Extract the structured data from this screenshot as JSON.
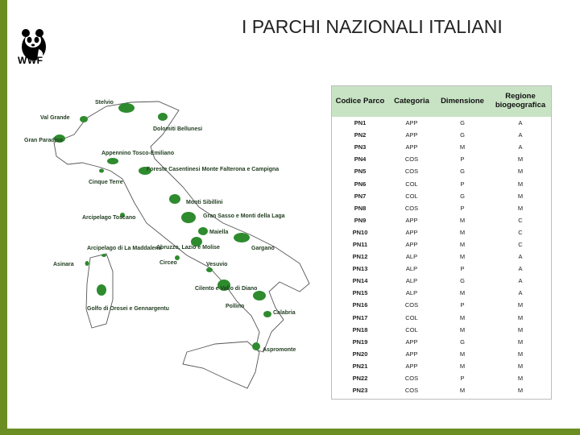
{
  "slide": {
    "title": "I PARCHI NAZIONALI ITALIANI",
    "logo_text": "WWF",
    "colors": {
      "frame": "#6b8e23",
      "header_fill": "#c8e3c4",
      "park_green": "#2e8b2e"
    }
  },
  "map": {
    "labels": [
      {
        "text": "Stelvio"
      },
      {
        "text": "Val Grande"
      },
      {
        "text": "Gran Paradiso"
      },
      {
        "text": "Dolomiti Bellunesi"
      },
      {
        "text": "Appennino Tosco-Emiliano"
      },
      {
        "text": "Foreste Casentinesi Monte Falterona e Campigna"
      },
      {
        "text": "Cinque Terre"
      },
      {
        "text": "Monti Sibillini"
      },
      {
        "text": "Arcipelago Toscano"
      },
      {
        "text": "Gran Sasso e Monti della Laga"
      },
      {
        "text": "Maiella"
      },
      {
        "text": "Gargano"
      },
      {
        "text": "Arcipelago di La Maddalena"
      },
      {
        "text": "Abruzzo, Lazio e Molise"
      },
      {
        "text": "Asinara"
      },
      {
        "text": "Circeo"
      },
      {
        "text": "Vesuvio"
      },
      {
        "text": "Cilento e Vallo di Diano"
      },
      {
        "text": "Golfo di Orosei e Gennargentu"
      },
      {
        "text": "Pollino"
      },
      {
        "text": "Calabria"
      },
      {
        "text": "Aspromonte"
      }
    ]
  },
  "table": {
    "headers": [
      "Codice Parco",
      "Categoria",
      "Dimensione",
      "Regione biogeografica"
    ],
    "rows": [
      [
        "PN1",
        "APP",
        "G",
        "A"
      ],
      [
        "PN2",
        "APP",
        "G",
        "A"
      ],
      [
        "PN3",
        "APP",
        "M",
        "A"
      ],
      [
        "PN4",
        "COS",
        "P",
        "M"
      ],
      [
        "PN5",
        "COS",
        "G",
        "M"
      ],
      [
        "PN6",
        "COL",
        "P",
        "M"
      ],
      [
        "PN7",
        "COL",
        "G",
        "M"
      ],
      [
        "PN8",
        "COS",
        "P",
        "M"
      ],
      [
        "PN9",
        "APP",
        "M",
        "C"
      ],
      [
        "PN10",
        "APP",
        "M",
        "C"
      ],
      [
        "PN11",
        "APP",
        "M",
        "C"
      ],
      [
        "PN12",
        "ALP",
        "M",
        "A"
      ],
      [
        "PN13",
        "ALP",
        "P",
        "A"
      ],
      [
        "PN14",
        "ALP",
        "G",
        "A"
      ],
      [
        "PN15",
        "ALP",
        "M",
        "A"
      ],
      [
        "PN16",
        "COS",
        "P",
        "M"
      ],
      [
        "PN17",
        "COL",
        "M",
        "M"
      ],
      [
        "PN18",
        "COL",
        "M",
        "M"
      ],
      [
        "PN19",
        "APP",
        "G",
        "M"
      ],
      [
        "PN20",
        "APP",
        "M",
        "M"
      ],
      [
        "PN21",
        "APP",
        "M",
        "M"
      ],
      [
        "PN22",
        "COS",
        "P",
        "M"
      ],
      [
        "PN23",
        "COS",
        "M",
        "M"
      ]
    ]
  }
}
